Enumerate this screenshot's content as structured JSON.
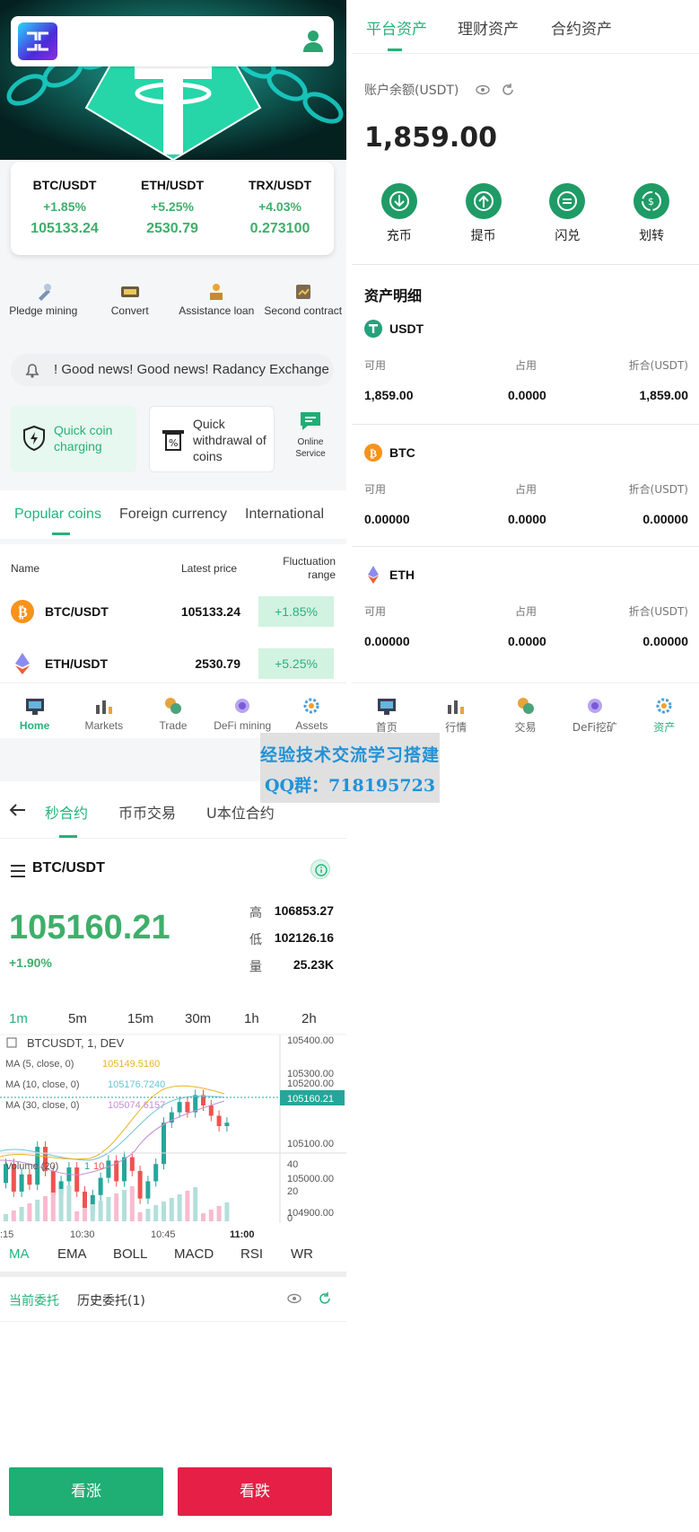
{
  "home": {
    "tickers": [
      {
        "pair": "BTC/USDT",
        "change": "+1.85%",
        "price": "105133.24"
      },
      {
        "pair": "ETH/USDT",
        "change": "+5.25%",
        "price": "2530.79"
      },
      {
        "pair": "TRX/USDT",
        "change": "+4.03%",
        "price": "0.273100"
      }
    ],
    "quick_menu": [
      {
        "label": "Pledge mining",
        "icon": "pledge-icon"
      },
      {
        "label": "Convert",
        "icon": "convert-icon"
      },
      {
        "label": "Assistance loan",
        "icon": "loan-icon"
      },
      {
        "label": "Second contract",
        "icon": "contract-icon"
      }
    ],
    "notice": "! Good news! Good news! Radancy Exchange",
    "quick_charge": "Quick coin charging",
    "quick_withdraw": "Quick withdrawal of coins",
    "online_service": "Online Service",
    "coin_tabs": [
      "Popular coins",
      "Foreign currency",
      "International"
    ],
    "market_headers": {
      "name": "Name",
      "price": "Latest price",
      "range": "Fluctuation range"
    },
    "market_rows": [
      {
        "pair": "BTC/USDT",
        "price": "105133.24",
        "change": "+1.85%"
      },
      {
        "pair": "ETH/USDT",
        "price": "2530.79",
        "change": "+5.25%"
      }
    ],
    "nav": [
      "Home",
      "Markets",
      "Trade",
      "DeFi mining",
      "Assets"
    ]
  },
  "assets": {
    "tabs": [
      "平台资产",
      "理财资产",
      "合约资产"
    ],
    "balance_label": "账户余额(USDT)",
    "balance": "1,859.00",
    "actions": [
      "充币",
      "提币",
      "闪兑",
      "划转"
    ],
    "detail_title": "资产明细",
    "columns": [
      "可用",
      "占用",
      "折合(USDT)"
    ],
    "items": [
      {
        "name": "USDT",
        "available": "1,859.00",
        "occupied": "0.0000",
        "converted": "1,859.00"
      },
      {
        "name": "BTC",
        "available": "0.00000",
        "occupied": "0.0000",
        "converted": "0.00000"
      },
      {
        "name": "ETH",
        "available": "0.00000",
        "occupied": "0.0000",
        "converted": "0.00000"
      }
    ],
    "nav": [
      "首页",
      "行情",
      "交易",
      "DeFi挖矿",
      "资产"
    ]
  },
  "watermark": {
    "line1": "经验技术交流学习搭建",
    "line2": "QQ群：718195723"
  },
  "trade": {
    "tabs": [
      "秒合约",
      "币币交易",
      "U本位合约"
    ],
    "pair": "BTC/USDT",
    "price": "105160.21",
    "change": "+1.90%",
    "stats": [
      {
        "k": "高",
        "v": "106853.27"
      },
      {
        "k": "低",
        "v": "102126.16"
      },
      {
        "k": "量",
        "v": "25.23K"
      }
    ],
    "timeframes": [
      "1m",
      "5m",
      "15m",
      "30m",
      "1h",
      "2h"
    ],
    "chart": {
      "symbol": "BTCUSDT, 1, DEV",
      "ma5_label": "MA (5, close, 0)",
      "ma5_value": "105149.5160",
      "ma10_label": "MA (10, close, 0)",
      "ma10_value": "105176.7240",
      "ma30_label": "MA (30, close, 0)",
      "ma30_value": "105074.6157",
      "price_axis": [
        "105400.00",
        "105300.00",
        "105200.00",
        "105100.00",
        "105000.00",
        "104900.00"
      ],
      "current_price_tag": "105160.21",
      "volume_label": "Volume (20)",
      "volume_values": [
        "1",
        "10"
      ],
      "volume_axis": [
        "40",
        "20",
        "0"
      ],
      "time_axis": [
        ":15",
        "10:30",
        "10:45",
        "11:00"
      ],
      "colors": {
        "up": "#26a69a",
        "down": "#ef5350",
        "ma5": "#e8b320",
        "ma10": "#6cc3d8",
        "ma30": "#c48fd6"
      }
    },
    "indicators": [
      "MA",
      "EMA",
      "BOLL",
      "MACD",
      "RSI",
      "WR"
    ],
    "order_tabs": [
      "当前委托",
      "历史委托(1)"
    ],
    "buy_up": "看涨",
    "buy_down": "看跌"
  }
}
